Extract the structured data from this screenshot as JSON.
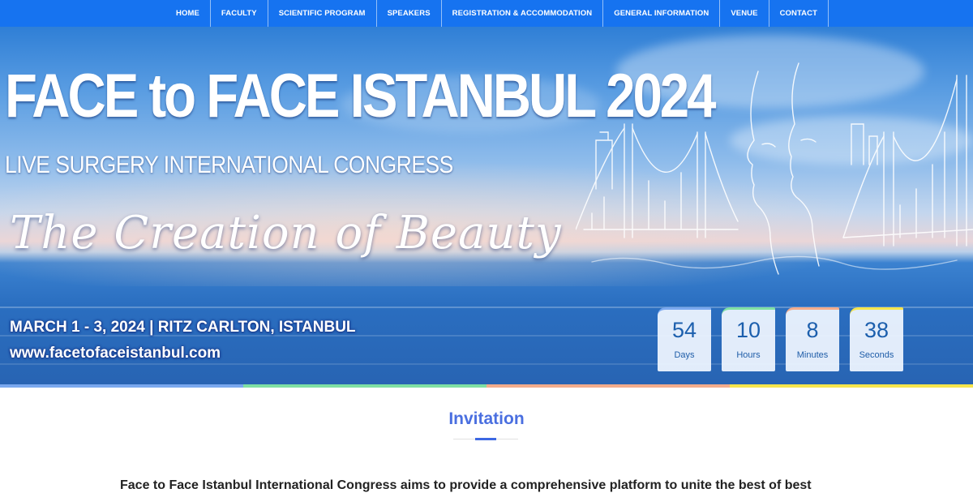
{
  "nav": {
    "items": [
      "HOME",
      "FACULTY",
      "SCIENTIFIC PROGRAM",
      "SPEAKERS",
      "REGISTRATION & ACCOMMODATION",
      "GENERAL INFORMATION",
      "VENUE",
      "CONTACT"
    ]
  },
  "hero": {
    "title": "FACE to FACE ISTANBUL 2024",
    "subtitle": "LIVE SURGERY INTERNATIONAL CONGRESS",
    "tagline": "The Creation of Beauty",
    "date_venue": "MARCH 1 - 3, 2024 | RITZ CARLTON, ISTANBUL",
    "url": "www.facetofaceistanbul.com",
    "artwork": "bridge-and-face-sketch"
  },
  "countdown": [
    {
      "value": "54",
      "label": "Days"
    },
    {
      "value": "10",
      "label": "Hours"
    },
    {
      "value": "8",
      "label": "Minutes"
    },
    {
      "value": "38",
      "label": "Seconds"
    }
  ],
  "strip_colors": [
    "#7aa8ef",
    "#7fe0a4",
    "#f3ac8c",
    "#f6e54c"
  ],
  "invitation": {
    "heading": "Invitation",
    "text": "Face to Face Istanbul International Congress aims to provide a comprehensive platform to unite the best of best"
  }
}
